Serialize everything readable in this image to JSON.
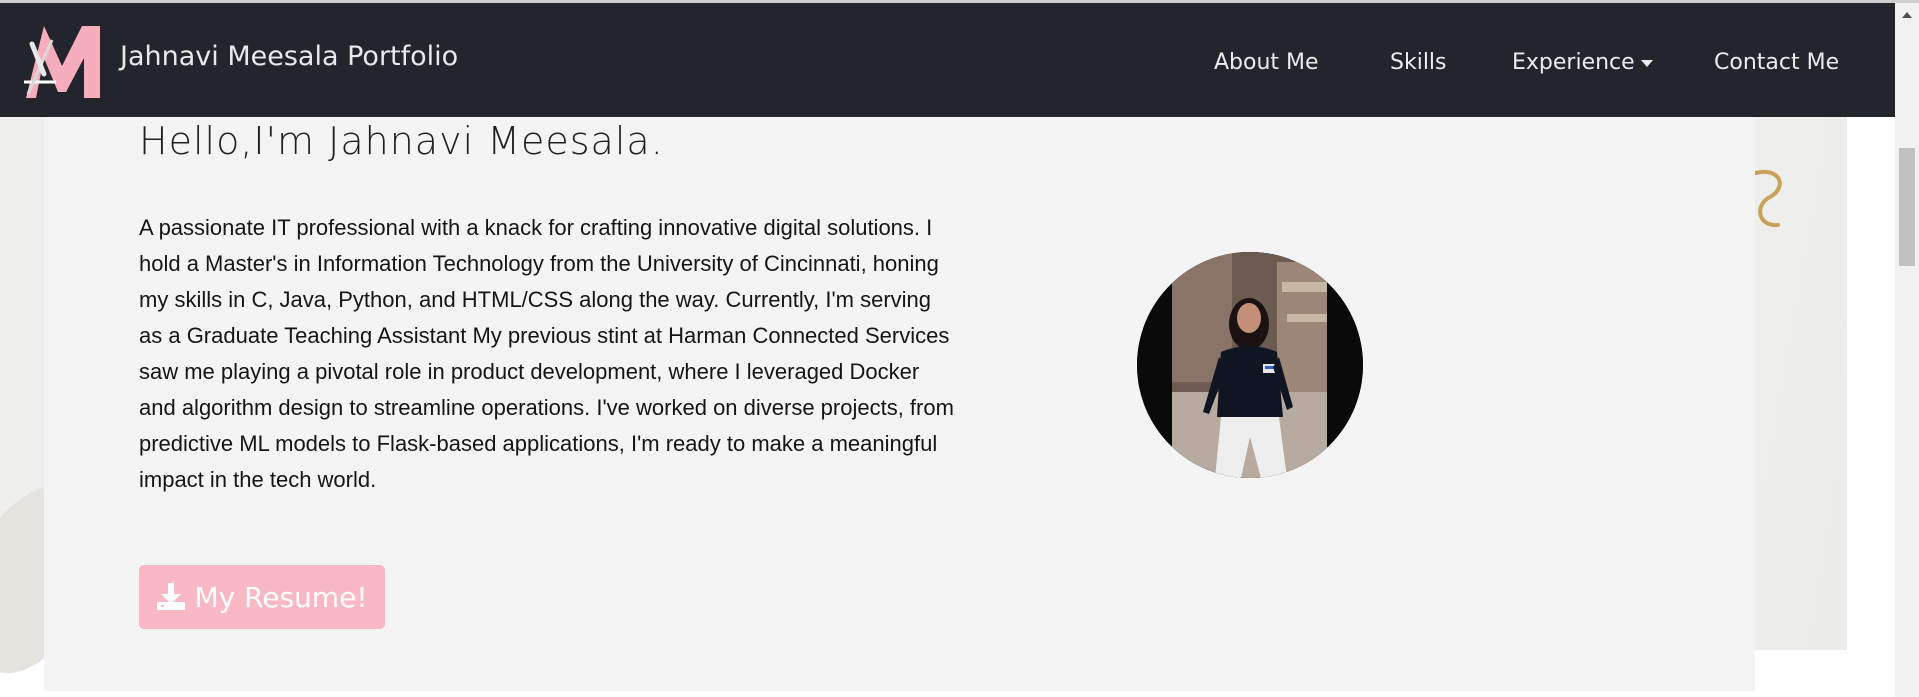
{
  "navbar": {
    "brand": "Jahnavi Meesala Portfolio",
    "logo_icon": "jm-monogram-logo-icon",
    "items": [
      {
        "label": "About Me"
      },
      {
        "label": "Skills"
      },
      {
        "label": "Experience",
        "has_dropdown": true
      },
      {
        "label": "Contact Me"
      }
    ],
    "background": "#23252d"
  },
  "hero": {
    "greeting": "Hello,I'm Jahnavi Meesala.",
    "bio": "A passionate IT professional with a knack for crafting innovative digital solutions. I hold a Master's in Information Technology from the University of Cincinnati, honing my skills in C, Java, Python, and HTML/CSS along the way. Currently, I'm serving as a Graduate Teaching Assistant My previous stint at Harman Connected Services saw me playing a pivotal role in product development, where I leveraged Docker and algorithm design to streamline operations. I've worked on diverse projects, from predictive ML models to Flask-based applications, I'm ready to make a meaningful impact in the tech world.",
    "resume_button": {
      "label": "My Resume!",
      "icon": "download-icon",
      "color": "#f9b9c4"
    },
    "avatar": "profile-photo"
  },
  "colors": {
    "accent_pink": "#f7aebd",
    "card_bg": "#f4f4f4"
  }
}
